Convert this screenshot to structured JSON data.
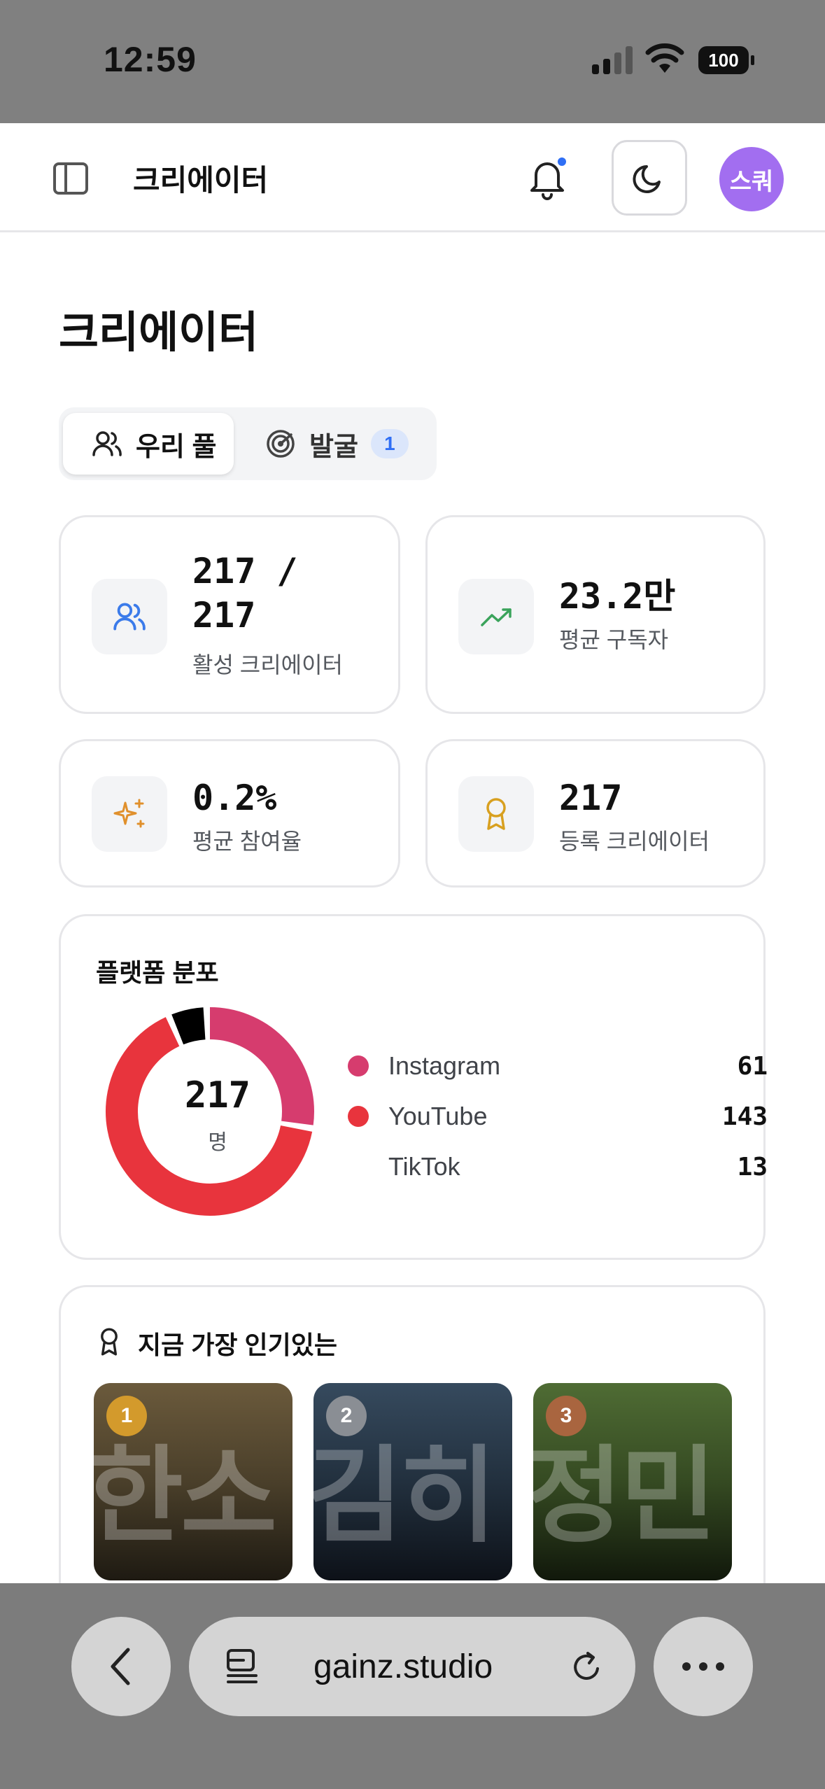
{
  "status_bar": {
    "time": "12:59",
    "battery": "100"
  },
  "header": {
    "title": "크리에이터",
    "avatar_text": "스쿼"
  },
  "page": {
    "title": "크리에이터"
  },
  "tabs": [
    {
      "label": "우리 풀",
      "active": true
    },
    {
      "label": "발굴",
      "badge": "1",
      "active": false
    }
  ],
  "stats": {
    "active": {
      "value_line1": "217 /",
      "value_line2": "217",
      "label": "활성 크리에이터",
      "icon": "users-icon"
    },
    "subscribers": {
      "value": "23.2만",
      "label": "평균 구독자",
      "icon": "trending-up-icon"
    },
    "engagement": {
      "value": "0.2%",
      "label": "평균 참여율",
      "icon": "sparkles-icon"
    },
    "registered": {
      "value": "217",
      "label": "등록 크리에이터",
      "icon": "award-icon"
    }
  },
  "platform": {
    "title": "플랫폼 분포",
    "total": "217",
    "unit": "명",
    "items": [
      {
        "name": "Instagram",
        "value": "61",
        "color": "#d63c6e"
      },
      {
        "name": "YouTube",
        "value": "143",
        "color": "#e8343d"
      },
      {
        "name": "TikTok",
        "value": "13",
        "color": "#000000"
      }
    ]
  },
  "chart_data": {
    "type": "pie",
    "categories": [
      "Instagram",
      "YouTube",
      "TikTok"
    ],
    "values": [
      61,
      143,
      13
    ]
  },
  "popular": {
    "title": "지금 가장 인기있는",
    "items": [
      {
        "rank": "1",
        "bg_text": "한소",
        "rank_color": "#d39a2c"
      },
      {
        "rank": "2",
        "bg_text": "김히",
        "rank_color": "#8a8e94"
      },
      {
        "rank": "3",
        "bg_text": "정민",
        "rank_color": "#a9653f"
      }
    ]
  },
  "browser": {
    "url": "gainz.studio"
  }
}
